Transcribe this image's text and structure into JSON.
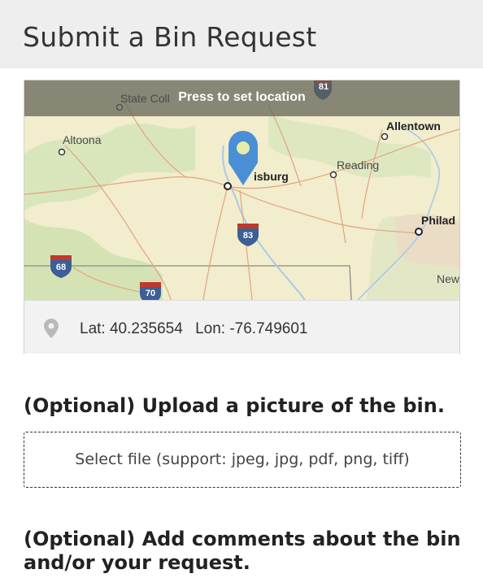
{
  "header": {
    "title": "Submit a Bin Request"
  },
  "map": {
    "banner": "Press to set location",
    "labels": {
      "state_college": "State Coll",
      "altoona": "Altoona",
      "allentown": "Allentown",
      "reading": "Reading",
      "harrisburg": "isburg",
      "philadelphia": "Philad",
      "new": "New"
    },
    "shields": {
      "i81": "81",
      "i83": "83",
      "i68": "68",
      "i70": "70"
    }
  },
  "location": {
    "lat": "Lat: 40.235654",
    "lon": "Lon: -76.749601"
  },
  "upload": {
    "title": "(Optional) Upload a picture of the bin.",
    "button": "Select file (support: jpeg, jpg, pdf, png, tiff)"
  },
  "comments": {
    "title": "(Optional) Add comments about the bin and/or your request."
  },
  "colors": {
    "pin": "#4a8fd6",
    "banner": "#5f5f55",
    "header": "#eeeeee"
  }
}
